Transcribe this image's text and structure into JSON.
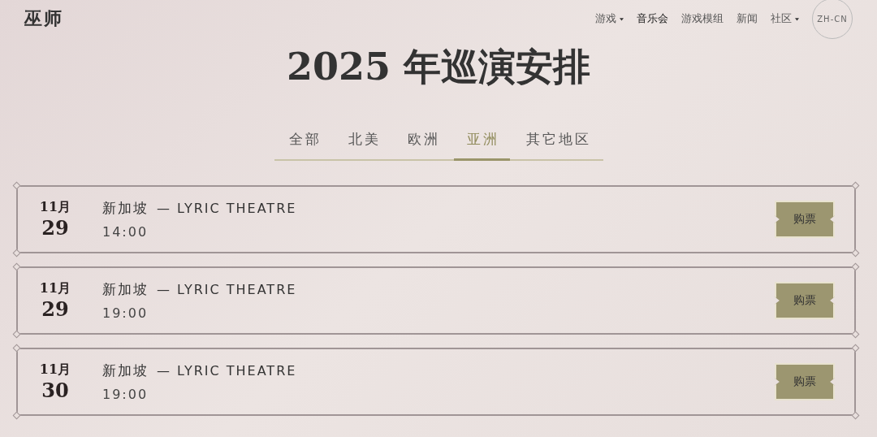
{
  "logo": "巫师",
  "nav": [
    {
      "label": "游戏",
      "selected": false,
      "dropdown": true
    },
    {
      "label": "音乐会",
      "selected": true,
      "dropdown": false
    },
    {
      "label": "游戏模组",
      "selected": false,
      "dropdown": false
    },
    {
      "label": "新闻",
      "selected": false,
      "dropdown": false
    },
    {
      "label": "社区",
      "selected": false,
      "dropdown": true
    }
  ],
  "language": "ZH-CN",
  "title": "2025 年巡演安排",
  "tabs": [
    {
      "label": "全部",
      "selected": false
    },
    {
      "label": "北美",
      "selected": false
    },
    {
      "label": "欧洲",
      "selected": false
    },
    {
      "label": "亚洲",
      "selected": true
    },
    {
      "label": "其它地区",
      "selected": false
    }
  ],
  "events": [
    {
      "month": "11月",
      "day": "29",
      "city": "新加坡",
      "venue": "— LYRIC THEATRE",
      "time": "14:00",
      "button": "购票"
    },
    {
      "month": "11月",
      "day": "29",
      "city": "新加坡",
      "venue": "— LYRIC THEATRE",
      "time": "19:00",
      "button": "购票"
    },
    {
      "month": "11月",
      "day": "30",
      "city": "新加坡",
      "venue": "— LYRIC THEATRE",
      "time": "19:00",
      "button": "购票"
    }
  ]
}
